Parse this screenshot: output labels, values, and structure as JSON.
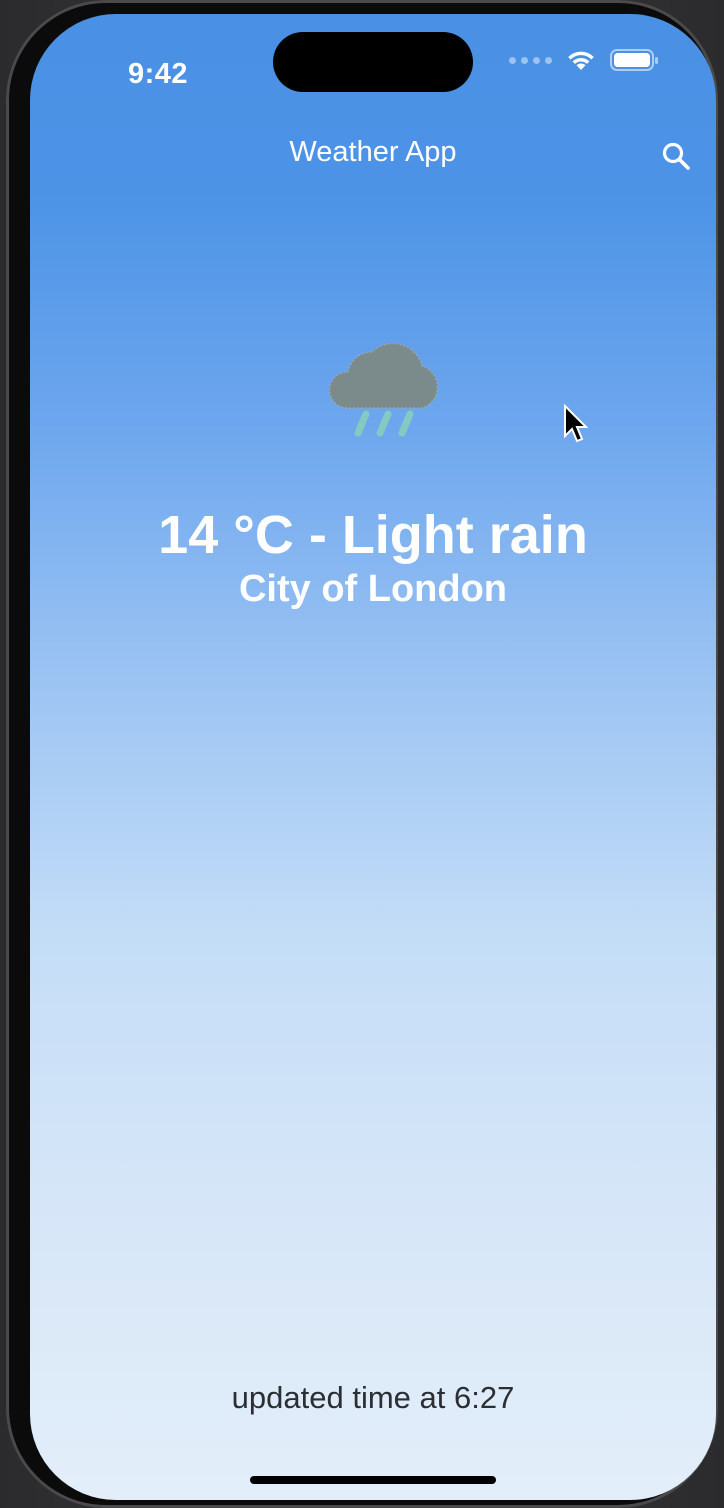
{
  "status_bar": {
    "time": "9:42",
    "icons": [
      "cellular-dots-icon",
      "wifi-icon",
      "battery-icon"
    ]
  },
  "header": {
    "title": "Weather App",
    "search_icon": "search-icon"
  },
  "weather": {
    "icon": "cloud-rain-icon",
    "temperature_condition": "14 °C - Light rain",
    "city": "City of London"
  },
  "footer": {
    "updated_text": "updated time at 6:27"
  },
  "colors": {
    "gradient_top": "#4a90e4",
    "gradient_bottom": "#e3eef9",
    "cloud": "#7b8a8b",
    "rain": "#86c9c1",
    "text_primary": "#ffffff",
    "text_footer": "#2b2e33"
  }
}
